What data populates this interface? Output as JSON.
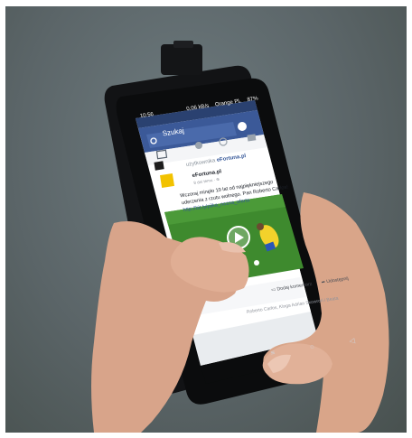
{
  "status_bar": {
    "time": "10:56",
    "network_speed": "0,06 kB/s",
    "carrier": "Orange PL",
    "battery": "87%"
  },
  "search": {
    "placeholder": "Szukaj"
  },
  "feed": {
    "user_prefix": "użytkownika",
    "page_name": "eFortuna.pl",
    "post_author": "eFortuna.pl",
    "post_meta": "8 dni temu · ⊕",
    "post_text_line1": "Wczoraj minęło 19 lat od najpiękniejszego",
    "post_text_line2": "uderzenia z rzutu wolnego. Pan Roberto Carlos!",
    "post_link": "http://bit.ly/pilka_nozna_oferta",
    "comment_action": "Dodaj komentarz",
    "share_action": "Udostępnij",
    "footer_text": "Roberto Carlos, Kinga Adrian Skowroń i Beata"
  },
  "nav_bar": {
    "back": "◁",
    "home": "○",
    "menu": "≡"
  },
  "colors": {
    "facebook_blue": "#3b5998",
    "status_bar": "#2a4170",
    "pitch_green": "#3e8a2e"
  }
}
